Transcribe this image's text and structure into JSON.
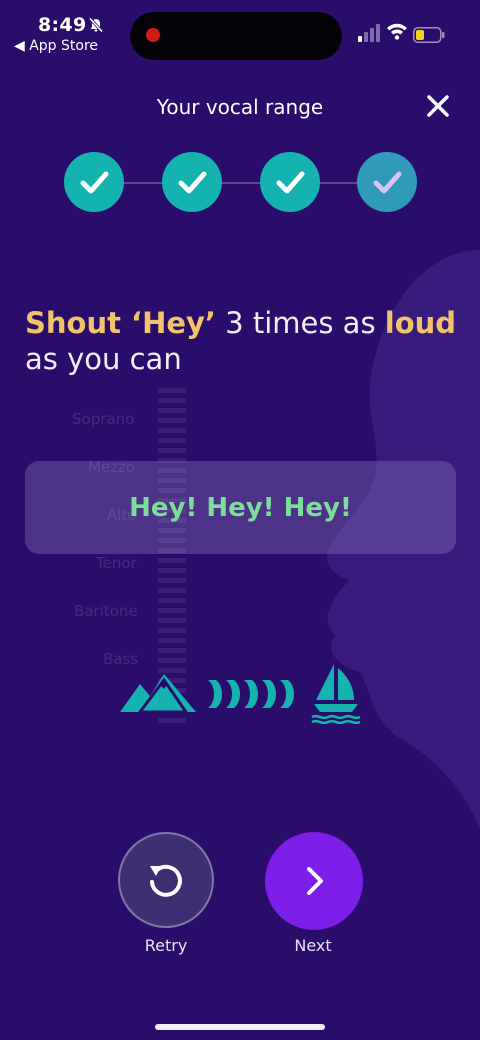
{
  "status_bar": {
    "time": "8:49",
    "back_app": "◀ App Store"
  },
  "header": {
    "title": "Your vocal range",
    "close_icon": "close-icon"
  },
  "progress": {
    "total_steps": 4,
    "completed_steps": 4
  },
  "instruction": {
    "part1": "Shout ‘Hey’",
    "part2": " 3 times as ",
    "part3": "loud",
    "part4": " as you can"
  },
  "background_scale": {
    "labels": [
      "Soprano",
      "Mezzo",
      "Alto",
      "Tenor",
      "Baritone",
      "Bass"
    ]
  },
  "card": {
    "text": "Hey! Hey! Hey!"
  },
  "volume_icons": [
    "mountains-icon",
    "waves-icon",
    "sailboat-icon"
  ],
  "buttons": {
    "retry_label": "Retry",
    "next_label": "Next"
  },
  "colors": {
    "background": "#2a0d6b",
    "accent_teal": "#14b3b0",
    "highlight_gold": "#f2c46a",
    "card_text_green": "#7dde99",
    "next_purple": "#7d1de8"
  }
}
